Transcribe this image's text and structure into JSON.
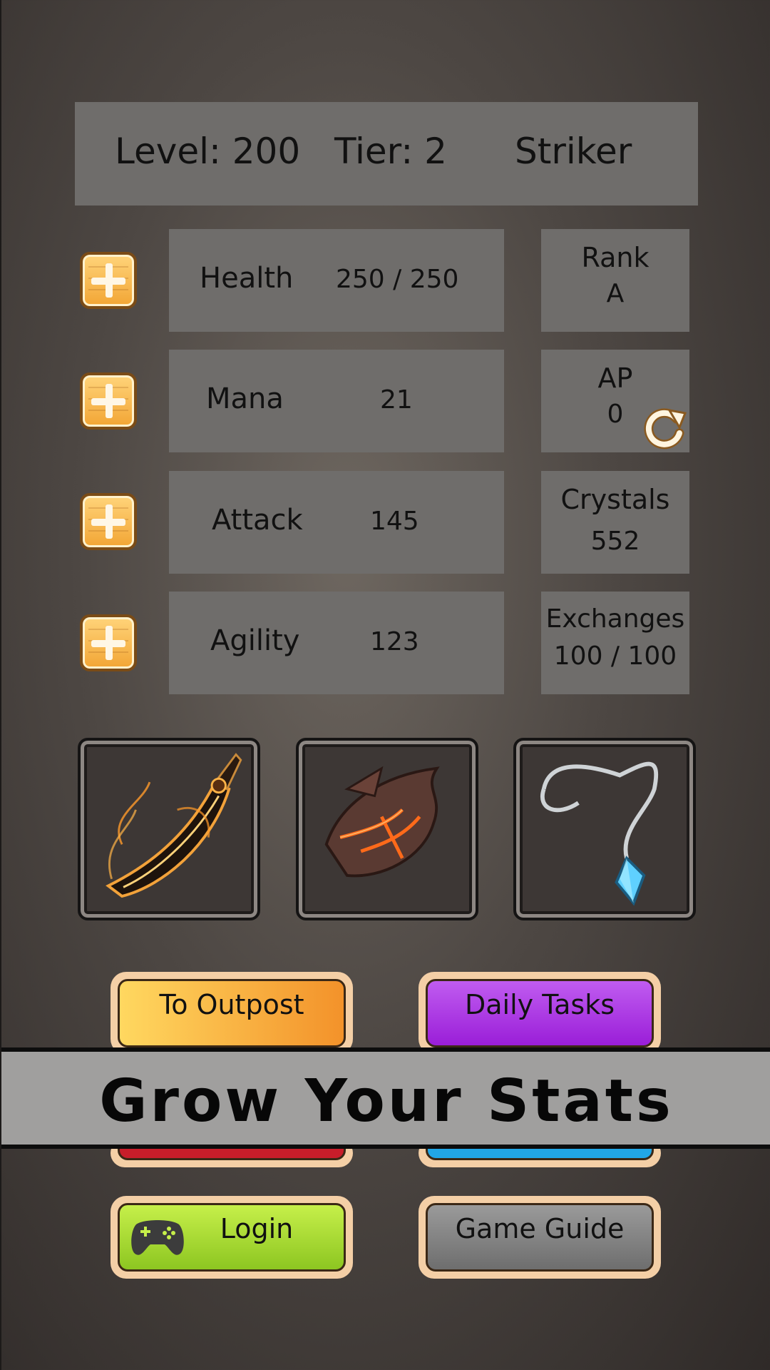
{
  "header": {
    "level": "Level: 200",
    "tier": "Tier: 2",
    "class": "Striker"
  },
  "stats": [
    {
      "name": "Health",
      "value": "250 / 250"
    },
    {
      "name": "Mana",
      "value": "21"
    },
    {
      "name": "Attack",
      "value": "145"
    },
    {
      "name": "Agility",
      "value": "123"
    }
  ],
  "side": [
    {
      "label": "Rank",
      "value": "A"
    },
    {
      "label": "AP",
      "value": "0"
    },
    {
      "label": "Crystals",
      "value": "552"
    },
    {
      "label": "Exchanges",
      "value": "100 / 100"
    }
  ],
  "equipment": [
    {
      "name": "flaming-sword-icon"
    },
    {
      "name": "lava-armor-icon"
    },
    {
      "name": "crystal-necklace-icon"
    }
  ],
  "buttons": {
    "outpost": "To Outpost",
    "daily": "Daily Tasks",
    "login": "Login",
    "guide": "Game Guide"
  },
  "banner": "Grow Your Stats",
  "colors": {
    "panel": "#6f6d6b",
    "outpost": "#f3922a",
    "daily": "#9a1ed8",
    "login": "#8dc621",
    "guide": "#6e6e6e",
    "red": "#c81d2a",
    "blue": "#21a6e6"
  }
}
